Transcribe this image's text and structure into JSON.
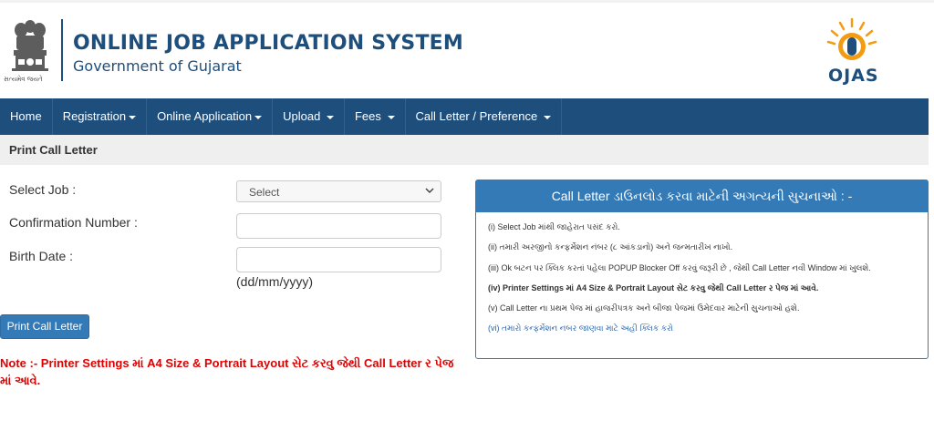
{
  "header": {
    "title": "ONLINE JOB APPLICATION SYSTEM",
    "subtitle": "Government of Gujarat",
    "emblem_motto": "સત્યમેવ જયતે",
    "logo_text": "OJAS"
  },
  "nav": {
    "items": [
      {
        "label": "Home",
        "dropdown": false
      },
      {
        "label": "Registration",
        "dropdown": true
      },
      {
        "label": "Online Application",
        "dropdown": true
      },
      {
        "label": "Upload",
        "dropdown": true
      },
      {
        "label": "Fees",
        "dropdown": true
      },
      {
        "label": "Call Letter / Preference",
        "dropdown": true
      }
    ]
  },
  "section": {
    "title": "Print Call Letter"
  },
  "form": {
    "select_job_label": "Select Job :",
    "select_job_value": "Select",
    "confirmation_label": "Confirmation Number :",
    "confirmation_value": "",
    "birth_date_label": "Birth Date :",
    "birth_date_value": "",
    "birth_date_hint": "(dd/mm/yyyy)",
    "submit_label": "Print Call Letter"
  },
  "note": "Note :- Printer Settings માં A4 Size & Portrait Layout સેટ કરવુ જેથી Call Letter ર પેજ માં આવે.",
  "panel": {
    "heading": "Call Letter ડાઉનલોડ કરવા માટેની અગત્યની સુચનાઓ : -",
    "lines": [
      "(i) Select Job માંથી જાહેરાત પસંદ કરો.",
      "(ii) તમારી અરજીનો કન્ફર્મેશન નંબર (૮ આંકડાનો) અને જન્મતારીખ નાખો.",
      "(iii) Ok બટન પર ક્લિક કરતાં પહેલા POPUP Blocker Off કરવું જરૂરી છે , જેથી Call Letter નવી Window માં ખુલશે.",
      "(iv) Printer Settings માં A4 Size & Portrait Layout સેટ કરવુ જેથી Call Letter ર પેજ માં આવે.",
      "(v) Call Letter ના પ્રથમ પેજ માં હાજરીપત્રક અને બીજા પેજમાં ઉમેદવાર માટેની સુચનાઓ હશે.",
      "(vi) તમારો કન્ફર્મેશન નબર જાણવા માટે અહી ક્લિક કરો"
    ]
  },
  "colors": {
    "brand_blue": "#1d4e7c",
    "panel_blue": "#337ab7",
    "note_red": "#e00000",
    "logo_orange": "#f39c12"
  }
}
